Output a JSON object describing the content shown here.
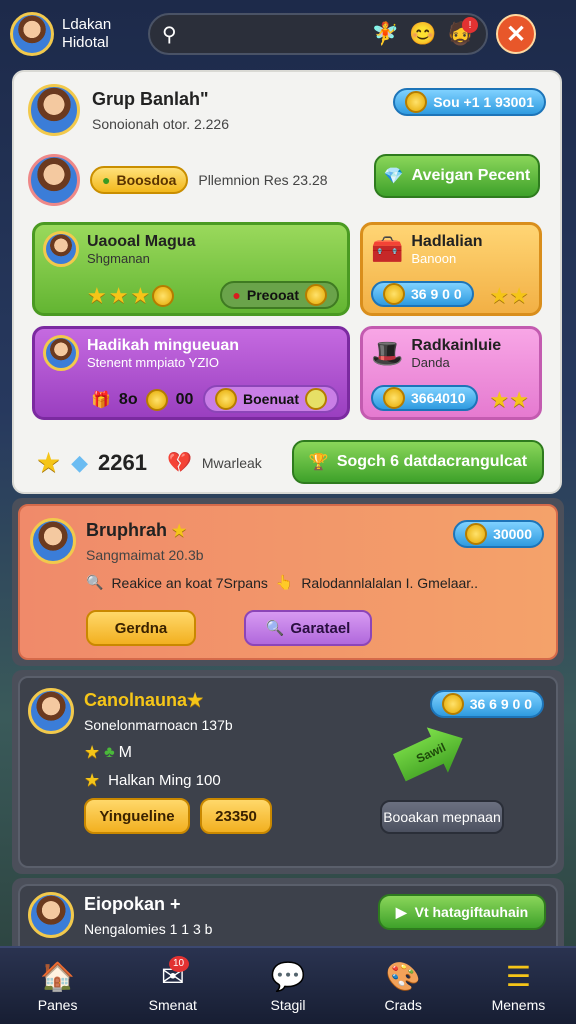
{
  "header": {
    "name_line1": "Ldakan",
    "name_line2": "Hidotal",
    "search_placeholder": "",
    "close_icon": "✕",
    "badge": "!"
  },
  "panel": {
    "title": "Grup Banlah\"",
    "subtitle": "Sonoionah otor. 2.226",
    "top_pill": "Sou +1 1 93001",
    "pill_green": "Boosdoa",
    "mid_text": "Pllemnion Res 23.28",
    "cta": "Aveigan Pecent",
    "cards": [
      {
        "name": "Uaooal Magua",
        "sub": "Shgmanan",
        "btn": "Preooat"
      },
      {
        "name": "Hadlalian",
        "sub": "Banoon",
        "pill": "36 9 0 0"
      },
      {
        "name": "Hadikah mingueuan",
        "sub": "Stenent mmpiato YZIO",
        "num1": "8o",
        "num2": "00",
        "btn": "Boenuat"
      },
      {
        "name": "Radkainluie",
        "sub": "Danda",
        "pill": "3664010"
      }
    ],
    "footer_count": "2261",
    "footer_label": "Mwarleak",
    "footer_cta": "Sogch 6 datdacrangulcat"
  },
  "section1": {
    "name": "Bruphrah",
    "sub": "Sangmaimat 20.3b",
    "desc1": "Reakice an koat 7Srpans",
    "desc2": "Ralodannlalalan I. Gmelaar..",
    "pill": "30000",
    "btn1": "Gerdna",
    "btn2": "Garatael"
  },
  "section2": {
    "name": "Canolnauna",
    "sub": "Sonelonmarnoacn 137b",
    "line1": "M",
    "line2": "Halkan Ming 100",
    "pill": "36 6 9 0 0",
    "btn1": "Yingueline",
    "btn2": "23350",
    "arrow": "Sawil",
    "btn3": "Booakan mepnaan"
  },
  "section3": {
    "name": "Eiopokan +",
    "sub": "Nengalomies 1 1 3 b",
    "btn": "Vt hatagiftauhain"
  },
  "nav": [
    {
      "label": "Panes",
      "icon": "home-icon",
      "glyph": "🏠"
    },
    {
      "label": "Smenat",
      "icon": "mail-icon",
      "glyph": "✉",
      "badge": "10"
    },
    {
      "label": "Stagil",
      "icon": "chat-icon",
      "glyph": "💬"
    },
    {
      "label": "Crads",
      "icon": "palette-icon",
      "glyph": "🎨"
    },
    {
      "label": "Menems",
      "icon": "menu-icon",
      "glyph": "☰"
    }
  ]
}
